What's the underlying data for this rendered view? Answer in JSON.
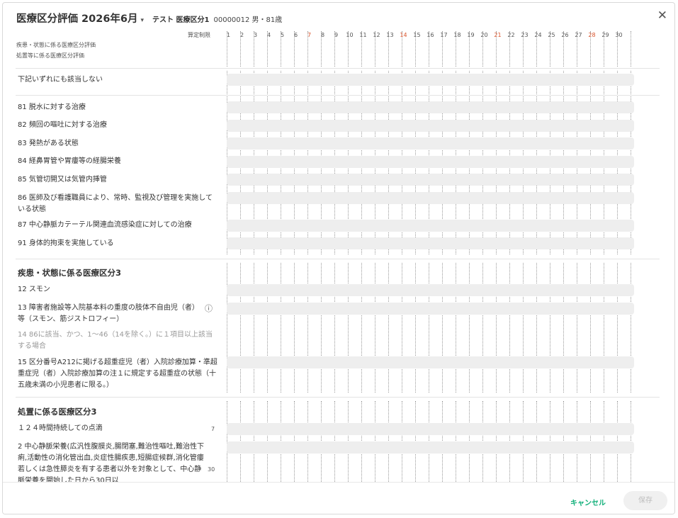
{
  "header": {
    "title": "医療区分評価 2026年6月",
    "caret": "▾",
    "patient_name": "テスト 医療区分1",
    "patient_info": "00000012 男・81歳",
    "close_glyph": "✕"
  },
  "columns": {
    "limit_label": "算定制限",
    "legend_disease": "疾患・状態に係る医療区分評価",
    "legend_treatment": "処置等に係る医療区分評価",
    "days": [
      "1",
      "2",
      "3",
      "4",
      "5",
      "6",
      "7",
      "8",
      "9",
      "10",
      "11",
      "12",
      "13",
      "14",
      "15",
      "16",
      "17",
      "18",
      "19",
      "20",
      "21",
      "22",
      "23",
      "24",
      "25",
      "26",
      "27",
      "28",
      "29",
      "30"
    ],
    "weekend_days": [
      "7",
      "14",
      "21",
      "28"
    ],
    "weekend_color": "#d9532b"
  },
  "groups": {
    "none": {
      "label": "下記いずれにも該当しない"
    },
    "general": [
      "81 脱水に対する治療",
      "82 頻回の嘔吐に対する治療",
      "83 発熱がある状態",
      "84 経鼻胃管や胃瘻等の経腸栄養",
      "85 気管切開又は気管内挿管",
      "86 医師及び看護職員により、常時、監視及び管理を実施している状態",
      "87 中心静脈カテーテル関連血流感染症に対しての治療",
      "91 身体的拘束を実施している"
    ],
    "disease": {
      "title": "疾患・状態に係る医療区分3",
      "items": [
        "12 スモン",
        "13 障害者施設等入院基本料の重度の肢体不自由児（者）等（スモン、筋ジストロフィー）",
        "14 86に該当、かつ、1～46（14を除く。）に１項目以上該当する場合",
        "15 区分番号A212に掲げる超重症児（者）入院診療加算・準超重症児（者）入院診療加算の注１に規定する超重症の状態（十五歳未満の小児患者に限る。）"
      ],
      "info_icon": "ⓘ"
    },
    "treatment": {
      "title": "処置に係る医療区分3",
      "items": [
        {
          "label": "１２４時間持続しての点滴",
          "limit": "7"
        },
        {
          "label": "2 中心静脈栄養(広汎性腹膜炎,腸閉塞,難治性嘔吐,難治性下痢,活動性の消化管出血,炎症性腸疾患,短腸症候群,消化管瘻若しくは急性膵炎を有する患者以外を対象として、中心静脈栄養を開始した日から30日以",
          "limit": "30"
        }
      ]
    }
  },
  "footer": {
    "cancel_label": "キャンセル",
    "save_label": "保存"
  },
  "colors": {
    "accent": "#11b07a",
    "bar": "#eeeeee"
  }
}
